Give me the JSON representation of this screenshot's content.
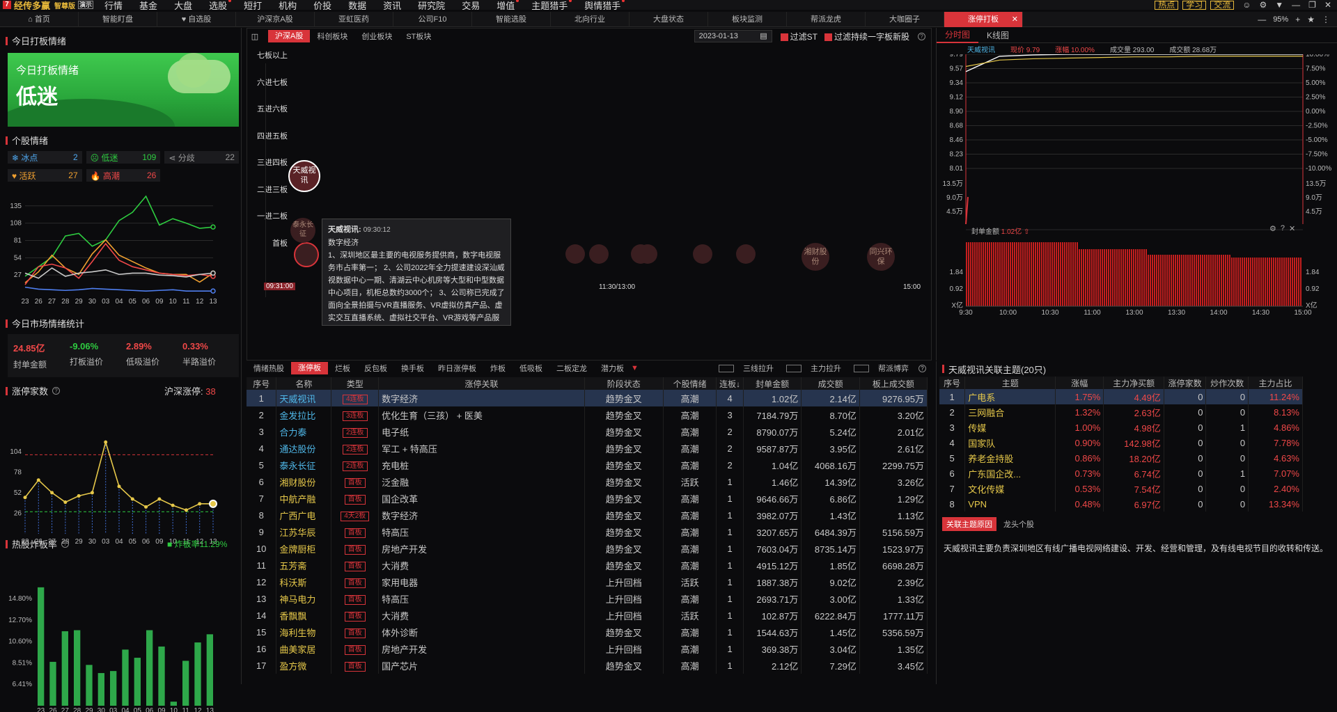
{
  "topbar": {
    "logo": "经传多赢",
    "edition": "智尊版",
    "demo": "演示",
    "menus": [
      "行情",
      "基金",
      "大盘",
      "选股",
      "短打",
      "机构",
      "价投",
      "数据",
      "资讯",
      "研究院",
      "交易",
      "增值",
      "主题猎手",
      "舆情猎手"
    ],
    "right_buttons": [
      "热点",
      "学习",
      "交流"
    ]
  },
  "tabs": [
    "首页",
    "智能盯盘",
    "自选股",
    "沪深京A股",
    "亚虹医药",
    "公司F10",
    "智能选股",
    "北向行业",
    "大盘状态",
    "板块监测",
    "帮派龙虎",
    "大咖圈子",
    "涨停打板"
  ],
  "tabs_right": {
    "zoom": "95%"
  },
  "left": {
    "today_title": "今日打板情绪",
    "banner_title": "今日打板情绪",
    "banner_value": "低迷",
    "stock_mood_title": "个股情绪",
    "moods": [
      {
        "label": "冰点",
        "value": "2",
        "color": "#4fa8f0"
      },
      {
        "label": "低迷",
        "value": "109",
        "color": "#2ecc40"
      },
      {
        "label": "分歧",
        "value": "22",
        "color": "#999999"
      },
      {
        "label": "活跃",
        "value": "27",
        "color": "#f0a030"
      },
      {
        "label": "高潮",
        "value": "26",
        "color": "#f04848"
      }
    ],
    "mood_chart": {
      "type": "line",
      "x": [
        "23",
        "26",
        "27",
        "28",
        "29",
        "30",
        "03",
        "04",
        "05",
        "06",
        "09",
        "10",
        "11",
        "12",
        "13"
      ],
      "yticks": [
        "135",
        "108",
        "81",
        "54",
        "27"
      ],
      "ylim": [
        0,
        150
      ],
      "series": [
        {
          "color": "#2ecc40",
          "values": [
            25,
            40,
            55,
            88,
            92,
            72,
            82,
            112,
            125,
            150,
            105,
            115,
            108,
            100,
            102
          ]
        },
        {
          "color": "#f0a030",
          "values": [
            15,
            32,
            58,
            38,
            28,
            60,
            82,
            58,
            48,
            38,
            30,
            28,
            28,
            16,
            30
          ]
        },
        {
          "color": "#f04848",
          "values": [
            12,
            40,
            44,
            38,
            22,
            48,
            76,
            50,
            40,
            35,
            30,
            28,
            26,
            28,
            25
          ]
        },
        {
          "color": "#cccccc",
          "values": [
            30,
            22,
            38,
            25,
            30,
            32,
            35,
            28,
            30,
            30,
            27,
            26,
            24,
            28,
            30
          ]
        },
        {
          "color": "#4f7ff0",
          "values": [
            8,
            5,
            4,
            3,
            4,
            6,
            5,
            4,
            3,
            2,
            3,
            4,
            2,
            2,
            2
          ]
        }
      ]
    },
    "market_stats_title": "今日市场情绪统计",
    "stats": [
      {
        "value": "24.85亿",
        "label": "封单金额",
        "color": "#f04848"
      },
      {
        "value": "-9.06%",
        "label": "打板溢价",
        "color": "#2ecc40"
      },
      {
        "value": "2.89%",
        "label": "低吸溢价",
        "color": "#f04848"
      },
      {
        "value": "0.33%",
        "label": "半路溢价",
        "color": "#f04848"
      }
    ],
    "limit_count_title": "涨停家数",
    "limit_count_label": "沪深涨停:",
    "limit_count_value": "38",
    "limit_chart": {
      "type": "line",
      "x": [
        "23",
        "26",
        "27",
        "28",
        "29",
        "30",
        "03",
        "04",
        "05",
        "06",
        "09",
        "10",
        "11",
        "12",
        "13"
      ],
      "yticks": [
        "104",
        "78",
        "52",
        "26"
      ],
      "ylim": [
        0,
        125
      ],
      "values": [
        46,
        68,
        52,
        40,
        48,
        52,
        116,
        60,
        44,
        34,
        44,
        36,
        30,
        38,
        38
      ],
      "ref_high": 100,
      "ref_low": 28
    },
    "blast_title": "热股炸板率",
    "blast_legend": "炸板率11.29%",
    "blast_chart": {
      "type": "bar",
      "x": [
        "23",
        "26",
        "27",
        "28",
        "29",
        "30",
        "03",
        "04",
        "05",
        "06",
        "09",
        "10",
        "11",
        "12",
        "13"
      ],
      "yticks": [
        "14.80%",
        "12.70%",
        "10.60%",
        "8.51%",
        "6.41%"
      ],
      "ylim": [
        4.3,
        16.3
      ],
      "values": [
        15.9,
        8.6,
        11.6,
        11.7,
        8.3,
        7.5,
        7.7,
        9.8,
        9.0,
        11.7,
        10.1,
        4.7,
        8.7,
        10.5,
        11.3
      ]
    }
  },
  "center": {
    "market_tabs": [
      "沪深A股",
      "科创板块",
      "创业板块",
      "ST板块"
    ],
    "date": "2023-01-13",
    "filter1": "过滤ST",
    "filter2": "过滤持续一字板新股",
    "levels": [
      "七板以上",
      "六进七板",
      "五进六板",
      "四进五板",
      "三进四板",
      "二进三板",
      "一进二板",
      "首板"
    ],
    "time_start": "09:31:00",
    "time_mid": "11:30/13:00",
    "time_end": "15:00",
    "bubble_main": "天威视讯",
    "bubble_side1": "泰永长征",
    "bubble_side2": "湘财股份",
    "bubble_side3": "同兴环保",
    "tooltip": {
      "name": "天威视讯:",
      "time": "09:30:12",
      "theme": "数字经济",
      "body": "1、深圳地区最主要的电视服务提供商，数字电视服务市占率第一； 2、公司2022年全力提速建设深汕威视数据中心一期、清湖云中心机房等大型和中型数据中心项目，机柜总数约3000个； 3、公司称已完成了面向全景拍摄与VR直播服务、VR虚拟仿真产品、虚实交互直播系统、虚拟社交平台、VR游戏等产品服务的规划布局"
    },
    "subtabs": [
      "情绪热股",
      "涨停板",
      "烂板",
      "反包板",
      "换手板",
      "昨日涨停板",
      "炸板",
      "低吸板",
      "二板定龙",
      "潜力板"
    ],
    "subtab_checks": [
      "三线拉升",
      "主力拉升",
      "帮派博弈"
    ],
    "table_headers": [
      "序号",
      "名称",
      "类型",
      "涨停关联",
      "阶段状态",
      "个股情绪",
      "连板↓",
      "封单金额",
      "成交额",
      "板上成交额"
    ],
    "rows": [
      [
        "1",
        "天威视讯",
        "4连板",
        "数字经济",
        "趋势金叉",
        "高潮",
        "4",
        "1.02亿",
        "2.14亿",
        "9276.95万"
      ],
      [
        "2",
        "金发拉比",
        "3连板",
        "优化生育（三孩） + 医美",
        "趋势金叉",
        "高潮",
        "3",
        "7184.79万",
        "8.70亿",
        "3.20亿"
      ],
      [
        "3",
        "合力泰",
        "2连板",
        "电子纸",
        "趋势金叉",
        "高潮",
        "2",
        "8790.07万",
        "5.24亿",
        "2.01亿"
      ],
      [
        "4",
        "通达股份",
        "2连板",
        "军工 + 特高压",
        "趋势金叉",
        "高潮",
        "2",
        "9587.87万",
        "3.95亿",
        "2.61亿"
      ],
      [
        "5",
        "泰永长征",
        "2连板",
        "充电桩",
        "趋势金叉",
        "高潮",
        "2",
        "1.04亿",
        "4068.16万",
        "2299.75万"
      ],
      [
        "6",
        "湘财股份",
        "首板",
        "泛金融",
        "趋势金叉",
        "活跃",
        "1",
        "1.46亿",
        "14.39亿",
        "3.26亿"
      ],
      [
        "7",
        "中航产融",
        "首板",
        "国企改革",
        "趋势金叉",
        "高潮",
        "1",
        "9646.66万",
        "6.86亿",
        "1.29亿"
      ],
      [
        "8",
        "广西广电",
        "4天2板",
        "数字经济",
        "趋势金叉",
        "高潮",
        "1",
        "3982.07万",
        "1.43亿",
        "1.13亿"
      ],
      [
        "9",
        "江苏华辰",
        "首板",
        "特高压",
        "趋势金叉",
        "高潮",
        "1",
        "3207.65万",
        "6484.39万",
        "5156.59万"
      ],
      [
        "10",
        "金牌厨柜",
        "首板",
        "房地产开发",
        "趋势金叉",
        "高潮",
        "1",
        "7603.04万",
        "8735.14万",
        "1523.97万"
      ],
      [
        "11",
        "五芳斋",
        "首板",
        "大消费",
        "趋势金叉",
        "高潮",
        "1",
        "4915.12万",
        "1.85亿",
        "6698.28万"
      ],
      [
        "12",
        "科沃斯",
        "首板",
        "家用电器",
        "上升回档",
        "活跃",
        "1",
        "1887.38万",
        "9.02亿",
        "2.39亿"
      ],
      [
        "13",
        "神马电力",
        "首板",
        "特高压",
        "上升回档",
        "高潮",
        "1",
        "2693.71万",
        "3.00亿",
        "1.33亿"
      ],
      [
        "14",
        "香飘飘",
        "首板",
        "大消费",
        "上升回档",
        "活跃",
        "1",
        "102.87万",
        "6222.84万",
        "1777.11万"
      ],
      [
        "15",
        "海利生物",
        "首板",
        "体外诊断",
        "趋势金叉",
        "高潮",
        "1",
        "1544.63万",
        "1.45亿",
        "5356.59万"
      ],
      [
        "16",
        "曲美家居",
        "首板",
        "房地产开发",
        "上升回档",
        "高潮",
        "1",
        "369.38万",
        "3.04亿",
        "1.35亿"
      ],
      [
        "17",
        "盈方微",
        "首板",
        "国产芯片",
        "趋势金叉",
        "高潮",
        "1",
        "2.12亿",
        "7.29亿",
        "3.45亿"
      ]
    ]
  },
  "right": {
    "tabs": [
      "分时图",
      "K线图"
    ],
    "quote": {
      "name": "天威视讯",
      "price": "现价 9.79",
      "change": "涨幅 10.00%",
      "vol": "成交量 293.00",
      "amount": "成交额 28.68万"
    },
    "price_axis_left": [
      "9.79",
      "9.57",
      "9.34",
      "9.12",
      "8.90",
      "8.68",
      "8.46",
      "8.23",
      "8.01"
    ],
    "price_axis_right": [
      "10.00%",
      "7.50%",
      "5.00%",
      "2.50%",
      "0.00%",
      "-2.50%",
      "-5.00%",
      "-7.50%",
      "-10.00%"
    ],
    "vol_axis": [
      "13.5万",
      "9.0万",
      "4.5万"
    ],
    "price_chart": {
      "type": "line",
      "ylim": [
        8.01,
        9.79
      ],
      "price": [
        9.52,
        9.76,
        9.78,
        9.79,
        9.79,
        9.79,
        9.79,
        9.79,
        9.79,
        9.79,
        9.79
      ],
      "avg": [
        9.6,
        9.7,
        9.72,
        9.73,
        9.74,
        9.75,
        9.75,
        9.76,
        9.76,
        9.76,
        9.76
      ]
    },
    "seal_title": "封单金额",
    "seal_value": "1.02亿",
    "seal_axis": [
      "1.84",
      "0.92",
      "X亿"
    ],
    "time_axis": [
      "9:30",
      "10:00",
      "10:30",
      "11:00",
      "13:00",
      "13:30",
      "14:00",
      "14:30",
      "15:00"
    ],
    "themes_title": "天威视讯关联主题(20只)",
    "theme_headers": [
      "序号",
      "主题",
      "涨幅",
      "主力净买额",
      "涨停家数",
      "炒作次数",
      "主力占比"
    ],
    "themes": [
      [
        "1",
        "广电系",
        "1.75%",
        "4.49亿",
        "0",
        "0",
        "11.24%"
      ],
      [
        "2",
        "三网融合",
        "1.32%",
        "2.63亿",
        "0",
        "0",
        "8.13%"
      ],
      [
        "3",
        "传媒",
        "1.00%",
        "4.98亿",
        "0",
        "1",
        "4.86%"
      ],
      [
        "4",
        "国家队",
        "0.90%",
        "142.98亿",
        "0",
        "0",
        "7.78%"
      ],
      [
        "5",
        "养老金持股",
        "0.86%",
        "18.20亿",
        "0",
        "0",
        "4.63%"
      ],
      [
        "6",
        "广东国企改...",
        "0.73%",
        "6.74亿",
        "0",
        "1",
        "7.07%"
      ],
      [
        "7",
        "文化传媒",
        "0.53%",
        "7.54亿",
        "0",
        "0",
        "2.40%"
      ],
      [
        "8",
        "VPN",
        "0.48%",
        "6.97亿",
        "0",
        "0",
        "13.34%"
      ]
    ],
    "bottom_tabs": [
      "关联主题原因",
      "龙头个股"
    ],
    "reason": "天威视讯主要负责深圳地区有线广播电视网络建设、开发、经营和管理，及有线电视节目的收转和传送。"
  }
}
